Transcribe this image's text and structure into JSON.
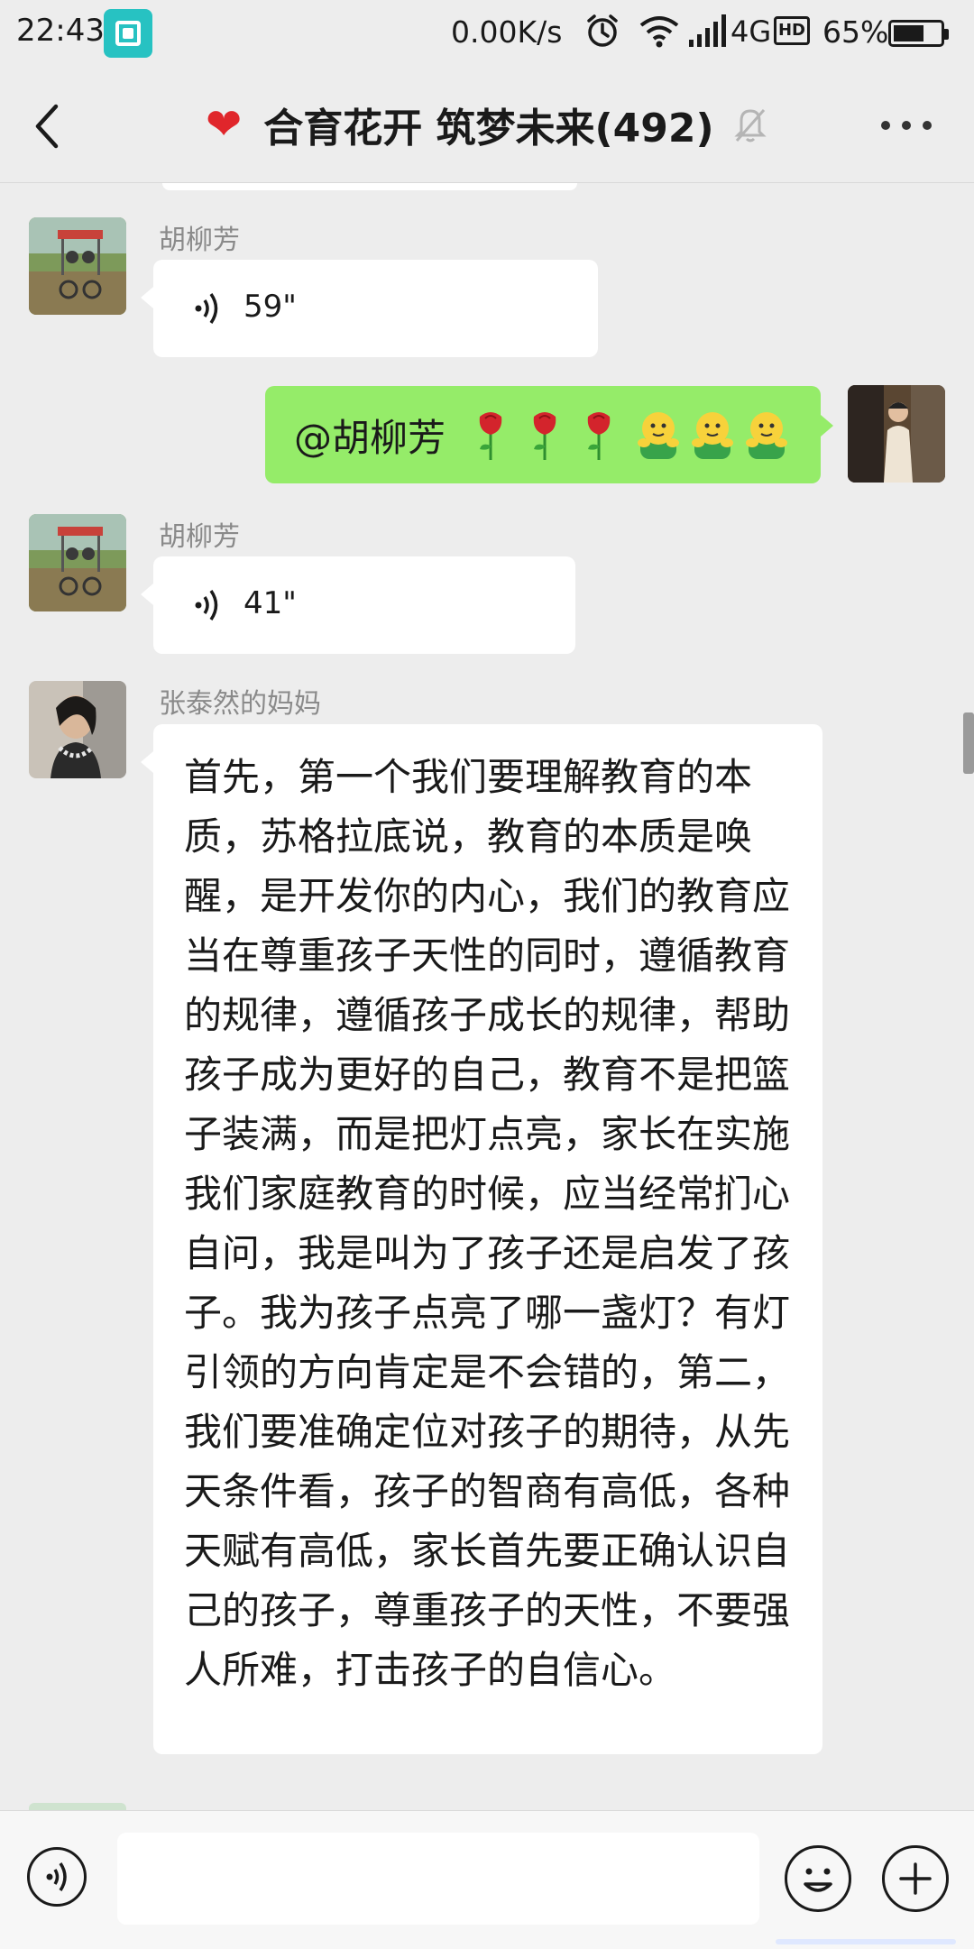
{
  "status_bar": {
    "time": "22:43",
    "net_speed": "0.00K/s",
    "network": "4G",
    "hd_label": "HD",
    "battery_percent": "65%",
    "battery_level": 0.65
  },
  "header": {
    "title": "合育花开 筑梦未来(492)",
    "title_icon": "heart-icon",
    "muted_icon": "bell-off-icon"
  },
  "messages": [
    {
      "type": "voice",
      "side": "left",
      "sender": "胡柳芳",
      "duration": "59\""
    },
    {
      "type": "text",
      "side": "right",
      "text": "@胡柳芳",
      "emojis": [
        "rose",
        "rose",
        "rose",
        "hug",
        "hug",
        "hug"
      ]
    },
    {
      "type": "voice",
      "side": "left",
      "sender": "胡柳芳",
      "duration": "41\""
    },
    {
      "type": "text",
      "side": "left",
      "sender": "张泰然的妈妈",
      "text": "首先，第一个我们要理解教育的本质，苏格拉底说，教育的本质是唤醒，是开发你的内心，我们的教育应当在尊重孩子天性的同时，遵循教育的规律，遵循孩子成长的规律，帮助孩子成为更好的自己，教育不是把篮子装满，而是把灯点亮，家长在实施我们家庭教育的时候，应当经常扪心自问，我是叫为了孩子还是启发了孩子。我为孩子点亮了哪一盏灯？有灯引领的方向肯定是不会错的，第二，我们要准确定位对孩子的期待，从先天条件看，孩子的智商有高低，各种天赋有高低，家长首先要正确认识自己的孩子，尊重孩子的天性，不要强人所难，打击孩子的自信心。"
    }
  ],
  "input_bar": {
    "value": "",
    "placeholder": ""
  },
  "colors": {
    "background": "#ededed",
    "outgoing_bubble": "#95ec69",
    "incoming_bubble": "#ffffff",
    "heart": "#e0262b"
  }
}
